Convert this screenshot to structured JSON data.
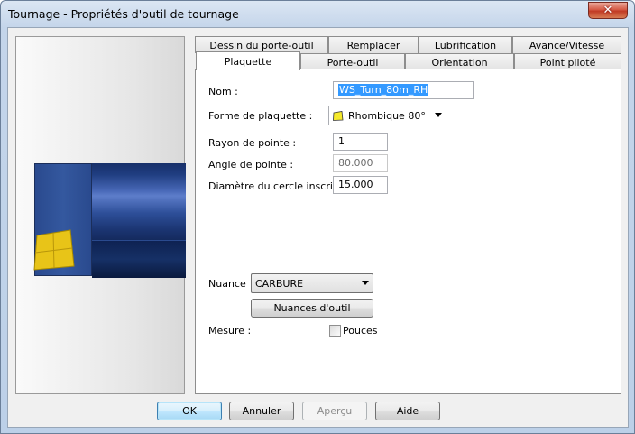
{
  "window": {
    "title": "Tournage - Propriétés d'outil de tournage",
    "close_glyph": "✕"
  },
  "tabs": {
    "row_back": [
      "Dessin du porte-outil",
      "Remplacer",
      "Lubrification",
      "Avance/Vitesse"
    ],
    "row_front": [
      "Plaquette",
      "Porte-outil",
      "Orientation",
      "Point piloté"
    ],
    "active": "Plaquette"
  },
  "form": {
    "name_label": "Nom :",
    "name_value": "WS_Turn_80m_RH",
    "shape_label": "Forme de plaquette :",
    "shape_value": "Rhombique 80°",
    "shape_icon": "rhombus-icon",
    "radius_label": "Rayon de pointe :",
    "radius_value": "1",
    "angle_label": "Angle de pointe :",
    "angle_value": "80.000",
    "diameter_label": "Diamètre du cercle inscrit",
    "diameter_value": "15.000",
    "grade_label": "Nuance",
    "grade_value": "CARBURE",
    "grades_button": "Nuances d'outil",
    "measure_label": "Mesure :",
    "inches_label": "Pouces",
    "inches_checked": false
  },
  "buttons": {
    "ok": "OK",
    "cancel": "Annuler",
    "preview": "Aperçu",
    "help": "Aide"
  },
  "colors": {
    "insert": "#e8c418",
    "holder": "#2a4a8e",
    "selection": "#3399ff"
  }
}
